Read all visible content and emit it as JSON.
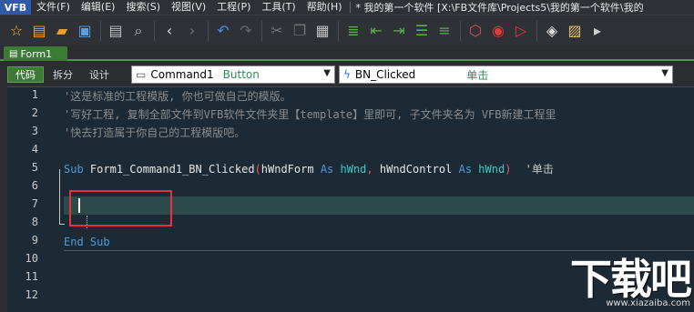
{
  "menubar": {
    "logo": "VFB",
    "items": [
      "文件(F)",
      "编辑(E)",
      "搜索(S)",
      "视图(V)",
      "工程(P)",
      "工具(T)",
      "帮助(H)"
    ],
    "title": "* 我的第一个软件 [X:\\FB文件库\\Projects5\\我的第一个软件\\我的"
  },
  "toolbar": {
    "icons": [
      {
        "name": "star-icon",
        "glyph": "☆",
        "color": "#f0c040"
      },
      {
        "name": "new-file-icon",
        "glyph": "▤",
        "color": "#f0a030"
      },
      {
        "name": "open-folder-icon",
        "glyph": "▰",
        "color": "#e8a030"
      },
      {
        "name": "save-icon",
        "glyph": "▣",
        "color": "#5aa0e0"
      },
      {
        "name": "print-preview-icon",
        "glyph": "▤",
        "color": "#c0c0c0"
      },
      {
        "name": "find-icon",
        "glyph": "⌕",
        "color": "#c0c0c0"
      },
      {
        "name": "back-icon",
        "glyph": "‹",
        "color": "#e0e0e0"
      },
      {
        "name": "forward-icon",
        "glyph": "›",
        "color": "#777777"
      },
      {
        "name": "undo-icon",
        "glyph": "↶",
        "color": "#4a8ae0"
      },
      {
        "name": "redo-icon",
        "glyph": "↷",
        "color": "#666666"
      },
      {
        "name": "cut-icon",
        "glyph": "✂",
        "color": "#777777"
      },
      {
        "name": "copy-icon",
        "glyph": "❐",
        "color": "#777777"
      },
      {
        "name": "paste-icon",
        "glyph": "▦",
        "color": "#c0c0c0"
      },
      {
        "name": "indent-icon",
        "glyph": "≣",
        "color": "#5ab050"
      },
      {
        "name": "outdent-icon",
        "glyph": "⇤",
        "color": "#5ab050"
      },
      {
        "name": "comment-icon",
        "glyph": "⇥",
        "color": "#5ab050"
      },
      {
        "name": "list-icon",
        "glyph": "☰",
        "color": "#5ab050"
      },
      {
        "name": "uncomment-icon",
        "glyph": "≡",
        "color": "#5ab050"
      },
      {
        "name": "compile-icon",
        "glyph": "⬡",
        "color": "#e05050"
      },
      {
        "name": "run-icon",
        "glyph": "◉",
        "color": "#e03a3a"
      },
      {
        "name": "debug-run-icon",
        "glyph": "▷",
        "color": "#e03a3a"
      },
      {
        "name": "layers-icon",
        "glyph": "◈",
        "color": "#e0e0e0"
      },
      {
        "name": "image-icon",
        "glyph": "▨",
        "color": "#e0c070"
      },
      {
        "name": "more-icon",
        "glyph": "▸",
        "color": "#d0d0d0"
      }
    ]
  },
  "tabs": {
    "form_tab": "Form1"
  },
  "viewbar": {
    "code": "代码",
    "split": "拆分",
    "design": "设计",
    "control_name": "Command1",
    "control_type": "Button",
    "event_name": "BN_Clicked",
    "event_desc": "单击"
  },
  "editor": {
    "line_numbers": [
      "1",
      "2",
      "3",
      "4",
      "5",
      "6",
      "7",
      "8",
      "9",
      "10",
      "11",
      "12"
    ],
    "line1": "'这是标准的工程模版, 你也可做自己的模版。",
    "line2": "'写好工程, 复制全部文件到VFB软件文件夹里【template】里即可, 子文件夹名为 VFB新建工程里",
    "line3": "'快去打造属于你自己的工程模版吧。",
    "line5": {
      "sub": "Sub",
      "name": "Form1_Command1_BN_Clicked",
      "lparen": "(",
      "p1": "hWndForm",
      "as1": "As",
      "t1": "hWnd",
      "comma": ",",
      "p2": "hWndControl",
      "as2": "As",
      "t2": "hWnd",
      "rparen": ")",
      "comment": "'单击"
    },
    "line9": {
      "end": "End",
      "sub": "Sub"
    }
  },
  "watermark": {
    "big": "下载吧",
    "small": "www.xiazaiba.com"
  }
}
